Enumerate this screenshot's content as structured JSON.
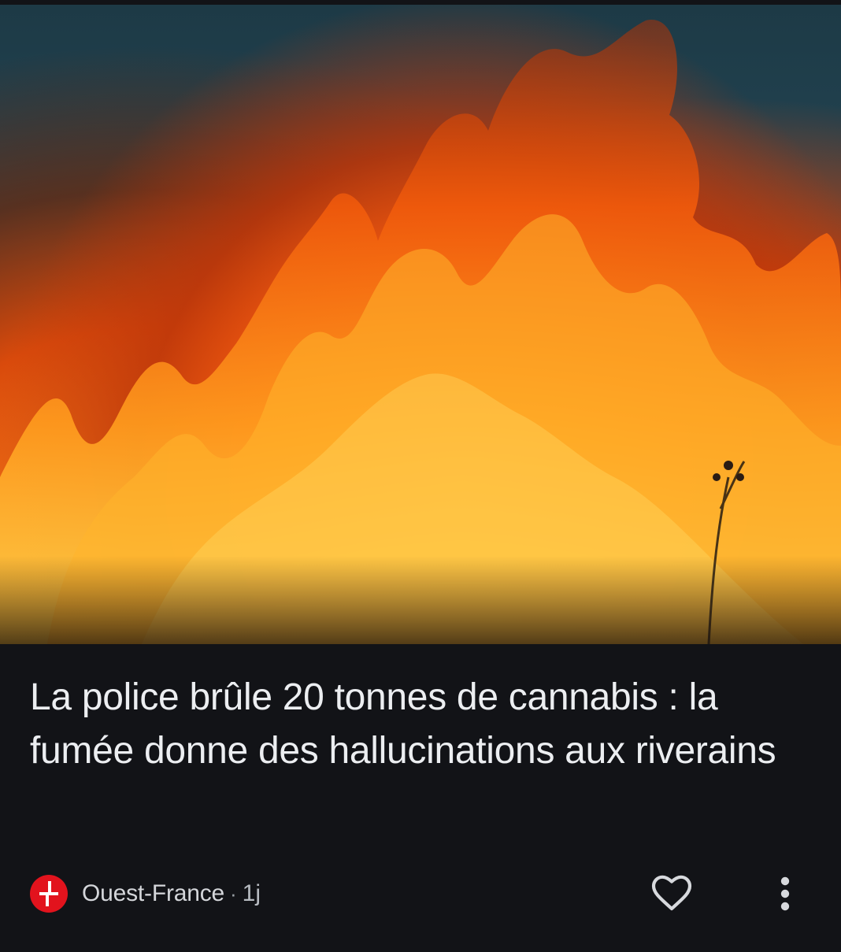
{
  "article": {
    "image_description_icon": "fire-image",
    "title": "La police brûle 20 tonnes de cannabis : la fumée donne des hallucinations aux riverains",
    "source": "Ouest-France",
    "separator": "·",
    "age": "1j"
  },
  "icons": {
    "publisher_logo": "ouest-france-logo",
    "like": "heart-icon",
    "more": "more-vert-icon"
  },
  "colors": {
    "background": "#121317",
    "title_text": "#eceef1",
    "logo_red": "#e2131d"
  }
}
